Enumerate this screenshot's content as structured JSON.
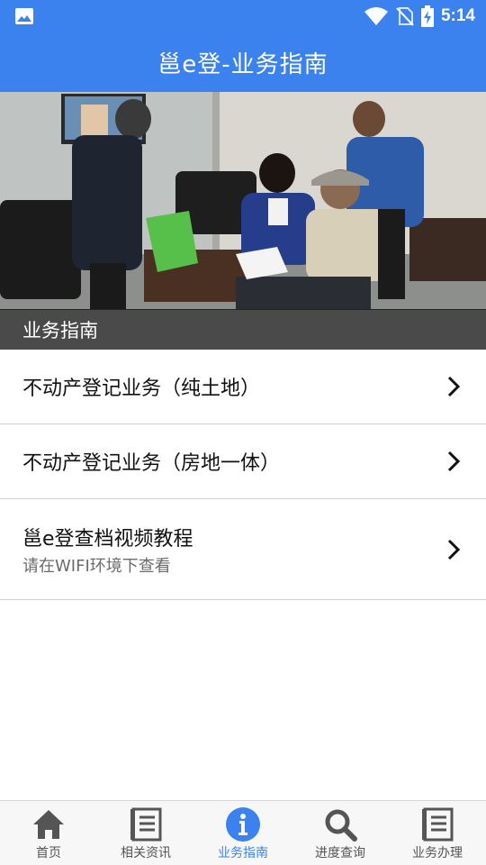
{
  "status_bar": {
    "time": "5:14",
    "icons": [
      "gallery-icon",
      "wifi-icon",
      "no-sim-icon",
      "battery-charging-icon"
    ]
  },
  "app_bar": {
    "title": "邕e登-业务指南"
  },
  "section": {
    "title": "业务指南"
  },
  "list": {
    "items": [
      {
        "label": "不动产登记业务（纯土地）",
        "sub": ""
      },
      {
        "label": "不动产登记业务（房地一体）",
        "sub": ""
      },
      {
        "label": "邕e登查档视频教程",
        "sub": "请在WIFI环境下查看"
      }
    ]
  },
  "tab_bar": {
    "active_index": 2,
    "active_color": "#3b82ee",
    "tabs": [
      {
        "label": "首页",
        "icon": "home-icon"
      },
      {
        "label": "相关资讯",
        "icon": "document-list-icon"
      },
      {
        "label": "业务指南",
        "icon": "info-icon"
      },
      {
        "label": "进度查询",
        "icon": "search-icon"
      },
      {
        "label": "业务办理",
        "icon": "document-list-icon"
      }
    ]
  },
  "colors": {
    "primary": "#3b82ee",
    "section_header": "#4a4a4a"
  }
}
